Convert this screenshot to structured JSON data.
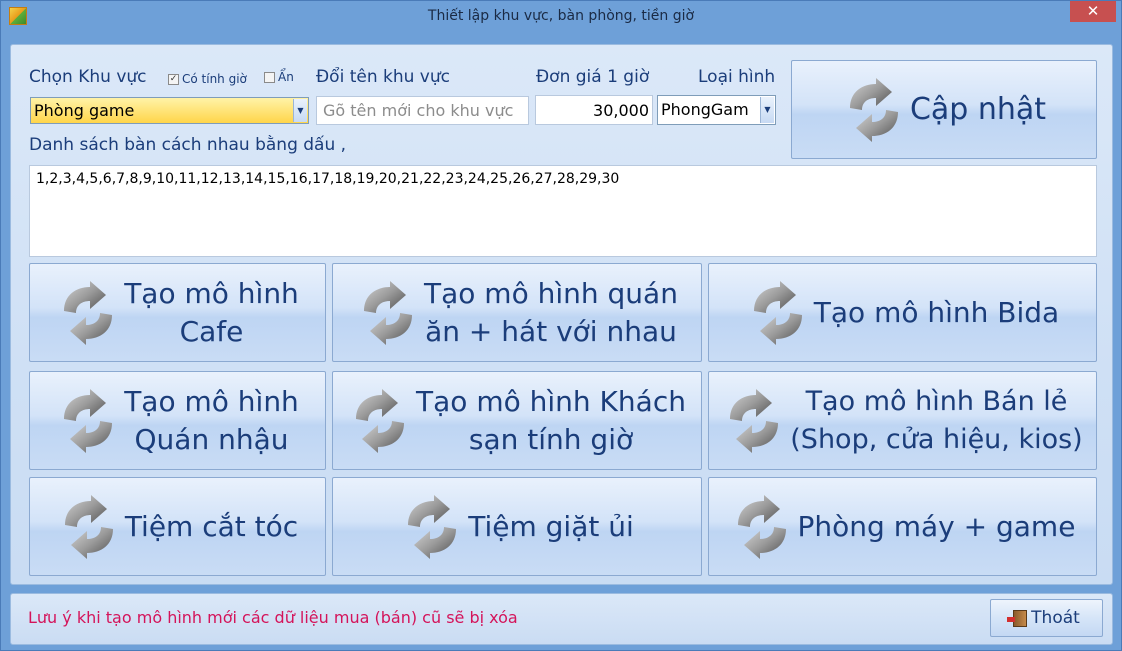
{
  "window": {
    "title": "Thiết lập khu vực, bàn phòng, tiền giờ",
    "close_label": "✕"
  },
  "form": {
    "area_label": "Chọn Khu vực",
    "timed_checkbox": {
      "label": "Có tính giờ",
      "checked": true
    },
    "hide_checkbox": {
      "label": "Ẩn",
      "checked": false
    },
    "rename_label": "Đổi tên khu vực",
    "rename_placeholder": "Gõ tên mới cho khu vực",
    "price_label": "Đơn giá 1 giờ",
    "price_value": "30,000",
    "type_label": "Loại hình",
    "area_selected": "Phòng game",
    "type_selected": "PhongGam",
    "tables_label": "Danh sách bàn cách nhau bằng dấu ,",
    "tables_value": "1,2,3,4,5,6,7,8,9,10,11,12,13,14,15,16,17,18,19,20,21,22,23,24,25,26,27,28,29,30"
  },
  "buttons": {
    "update": "Cập nhật",
    "cafe": [
      "Tạo mô hình",
      "Cafe"
    ],
    "restaurant_karaoke": [
      "Tạo mô hình quán",
      "ăn + hát với nhau"
    ],
    "billiards": [
      "Tạo mô hình Bida"
    ],
    "pub": [
      "Tạo mô hình",
      "Quán nhậu"
    ],
    "hotel": [
      "Tạo mô hình Khách",
      "sạn tính giờ"
    ],
    "retail": [
      "Tạo mô hình Bán lẻ",
      "(Shop, cửa hiệu, kios)"
    ],
    "barber": [
      "Tiệm cắt tóc"
    ],
    "laundry": [
      "Tiệm giặt ủi"
    ],
    "game_room": [
      "Phòng máy + game"
    ]
  },
  "footer": {
    "warning": "Lưu ý khi tạo mô hình mới các dữ liệu mua (bán) cũ sẽ bị xóa",
    "exit_label": "Thoát"
  },
  "colors": {
    "accent": "#1b3d7a",
    "warning": "#d4145a",
    "selected_combo": "#ffd54a"
  }
}
